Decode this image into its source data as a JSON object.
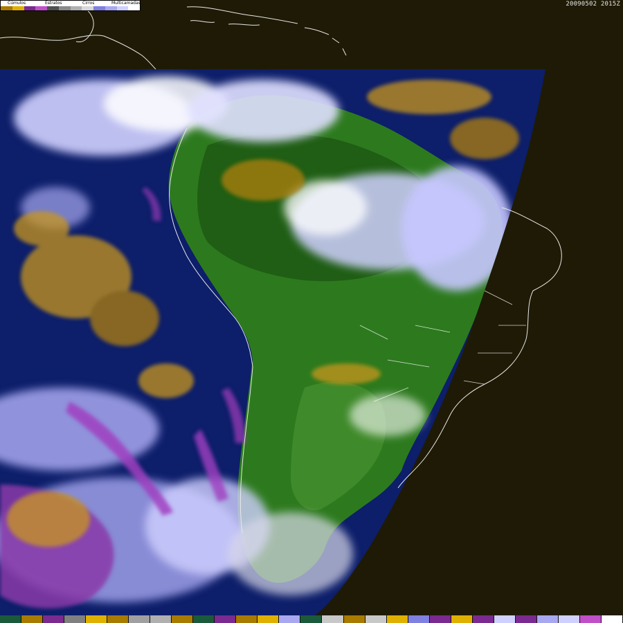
{
  "timestamp": "20090502 2015Z",
  "legend": {
    "labels": [
      "Cúmulos",
      "Estratos",
      "Cirros",
      "Multicamadas"
    ],
    "swatches": [
      "#a87a00",
      "#e0b000",
      "#7a2a90",
      "#c050c8",
      "#505050",
      "#8a8a8a",
      "#b0b0b0",
      "#d8d8d8",
      "#8080e0",
      "#a8a8f0",
      "#d0d0ff",
      "#ffffff"
    ]
  },
  "palette": {
    "space": "#1f1a05",
    "ocean": "#0d1e6a",
    "land": "#2d7a1e",
    "forest": "#1f5e14",
    "coast": "#e8e8e8",
    "border": "#ffffff"
  },
  "bottom_bar": {
    "colors": [
      "#1a5a3a",
      "#a87a00",
      "#7a2a90",
      "#808080",
      "#e0b000",
      "#a87a00",
      "#a0a0a0",
      "#b0b0b0",
      "#a87a00",
      "#1a5a3a",
      "#7a2a90",
      "#a87a00",
      "#e0b000",
      "#a8a8f0",
      "#1a5a3a",
      "#c8c8c8",
      "#a87a00",
      "#c8c8c8",
      "#e0b000",
      "#8080e0",
      "#7a2a90",
      "#e0b000",
      "#7a2a90",
      "#d0d0ff",
      "#7a2a90",
      "#a8a8f0",
      "#d0d0ff",
      "#c050c8",
      "#ffffff"
    ]
  }
}
